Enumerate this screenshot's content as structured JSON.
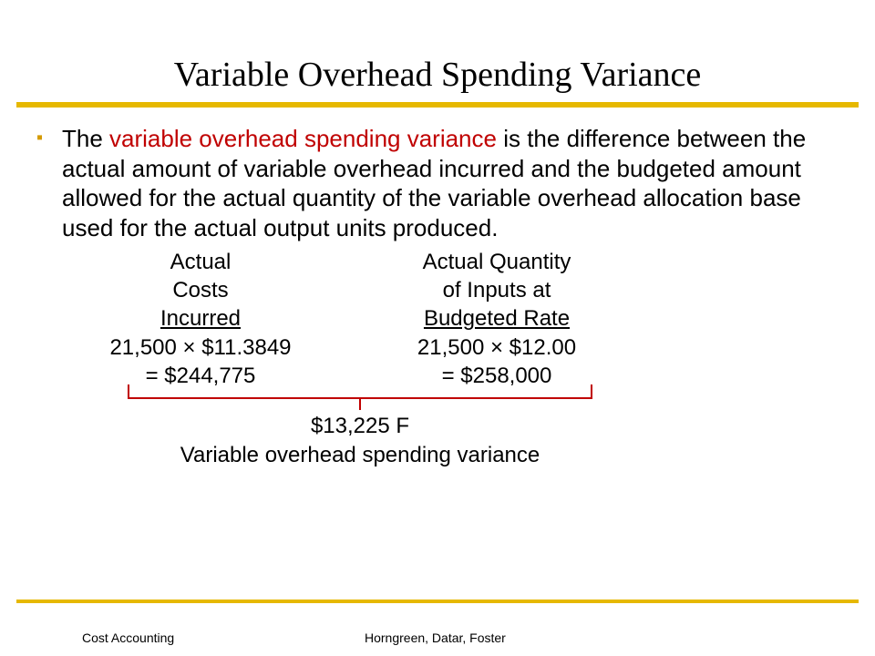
{
  "title": "Variable Overhead Spending Variance",
  "bullet": {
    "prefix": "The ",
    "em": "variable overhead spending variance",
    "suffix": " is  the difference between the actual amount of variable overhead incurred and the budgeted amount allowed for the actual quantity of the variable overhead allocation base used for the actual output units produced."
  },
  "cols": {
    "left": {
      "h1": "Actual",
      "h2": "Costs",
      "h3": " Incurred",
      "calc": "21,500 × $11.3849",
      "result": "= $244,775"
    },
    "right": {
      "h1": "Actual Quantity",
      "h2": "of Inputs at",
      "h3": "Budgeted Rate",
      "calc": "21,500 × $12.00",
      "result": "= $258,000"
    }
  },
  "variance": {
    "amount": "$13,225 F",
    "label": "Variable overhead spending variance"
  },
  "footer": {
    "left": "Cost Accounting",
    "right": "Horngreen, Datar, Foster"
  }
}
